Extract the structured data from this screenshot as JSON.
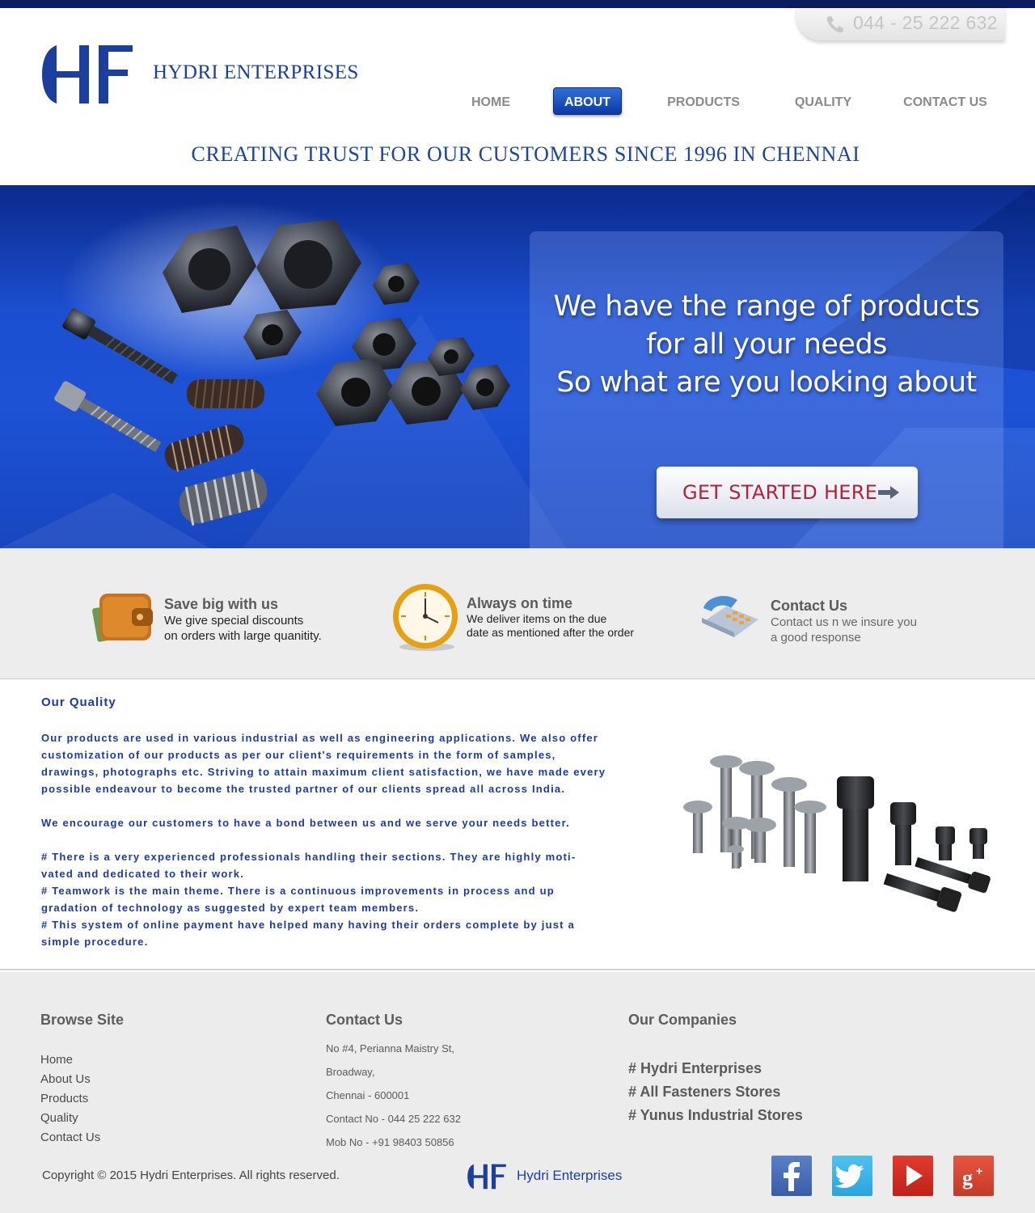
{
  "header": {
    "phone": "044 - 25 222 632",
    "brand_name": "HYDRI ENTERPRISES",
    "tagline": "CREATING TRUST FOR OUR CUSTOMERS SINCE 1996 IN CHENNAI"
  },
  "nav": {
    "items": [
      {
        "label": "HOME"
      },
      {
        "label": "ABOUT",
        "active": true
      },
      {
        "label": "PRODUCTS"
      },
      {
        "label": "QUALITY"
      },
      {
        "label": "CONTACT US"
      }
    ]
  },
  "hero": {
    "lines": [
      "We have the range of products",
      "for all your needs",
      "So what are you looking about"
    ],
    "cta_label": "GET STARTED HERE"
  },
  "features": [
    {
      "title": "Save big with us",
      "desc_line1": "We give special discounts",
      "desc_line2": "on orders with large quanitity.",
      "icon": "wallet-icon"
    },
    {
      "title": "Always on time",
      "desc_line1": "We deliver items on the due",
      "desc_line2": "date as mentioned after the order",
      "icon": "clock-icon"
    },
    {
      "title": "Contact Us",
      "desc_line1": "Contact us n we insure you",
      "desc_line2": "a good response",
      "icon": "telephone-icon"
    }
  ],
  "quality": {
    "title": "Our Quality",
    "para1": "Our products are used in various industrial as well as engineering applications. We also offer customization of our products as per our client's requirements in the form of samples, drawings, photographs etc. Striving to attain maximum client satisfaction, we have made every possible endeavour to become the trusted partner of our clients spread all across India.",
    "para2": "We encourage our customers to have a bond between us and we serve your needs better.",
    "bullet1": "# There is a very experienced professionals handling their sections. They are highly moti-vated and dedicated to their work.",
    "bullet2": "# Teamwork is the main theme. There is a continuous improvements in process and up gradation of technology as suggested by expert team members.",
    "bullet3": "# This system of online payment have helped many having their orders complete by just a simple procedure."
  },
  "footer": {
    "browse_title": "Browse Site",
    "browse_links": [
      "Home",
      "About Us",
      "Products",
      "Quality",
      "Contact Us"
    ],
    "contact_title": "Contact Us",
    "address_lines": [
      "No #4, Perianna Maistry St,",
      "Broadway,",
      "Chennai - 600001",
      "Contact No - 044 25 222 632",
      "Mob No - +91 98403 50856"
    ],
    "companies_title": "Our Companies",
    "companies": [
      "# Hydri Enterprises",
      "# All Fasteners Stores",
      "# Yunus Industrial Stores"
    ],
    "copyright": "Copyright © 2015 Hydri Enterprises. All rights reserved.",
    "brand": "Hydri Enterprises",
    "social": [
      "facebook-icon",
      "twitter-icon",
      "youtube-icon",
      "google-plus-icon"
    ]
  },
  "colors": {
    "brand_blue": "#1a3f9e",
    "top_bar": "#0c1c5c",
    "cta_text": "#b0213c",
    "hero_blue": "#1d52d6"
  }
}
